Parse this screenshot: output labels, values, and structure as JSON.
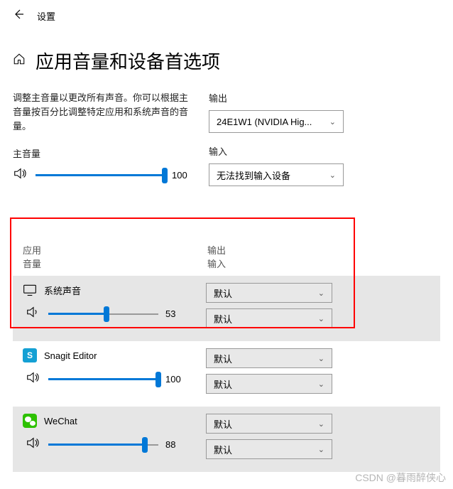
{
  "header": {
    "title": "设置"
  },
  "page": {
    "title": "应用音量和设备首选项"
  },
  "description": "调整主音量以更改所有声音。你可以根据主音量按百分比调整特定应用和系统声音的音量。",
  "master": {
    "label": "主音量",
    "value": "100",
    "percent": 100
  },
  "output": {
    "label": "输出",
    "selected": "24E1W1 (NVIDIA Hig..."
  },
  "input": {
    "label": "输入",
    "selected": "无法找到输入设备"
  },
  "apps_header": {
    "app": "应用",
    "volume": "音量",
    "output": "输出",
    "input": "输入"
  },
  "default_label": "默认",
  "apps": [
    {
      "name": "系统声音",
      "value": "53",
      "percent": 53,
      "output": "默认",
      "input": "默认"
    },
    {
      "name": "Snagit Editor",
      "value": "100",
      "percent": 100,
      "output": "默认",
      "input": "默认"
    },
    {
      "name": "WeChat",
      "value": "88",
      "percent": 88,
      "output": "默认",
      "input": "默认"
    }
  ],
  "watermark": "CSDN @暮雨醉侠心"
}
